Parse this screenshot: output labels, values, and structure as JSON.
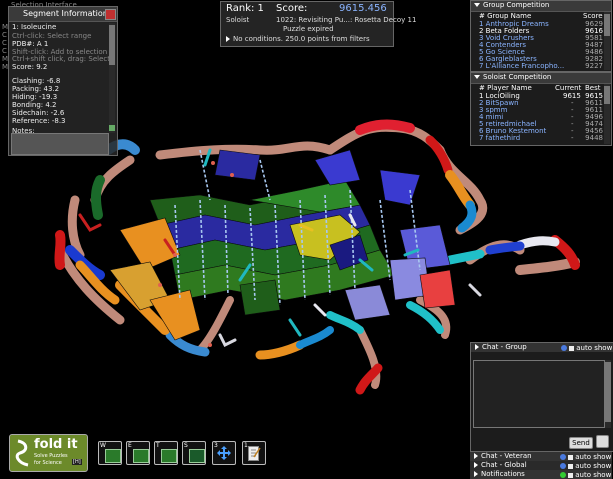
{
  "segment_panel": {
    "title": "Segment Information",
    "overlay_lines": [
      "Selection Interface",
      "M",
      "C",
      "C",
      "C",
      "M",
      "M"
    ],
    "residue": "1: Isoleucine",
    "hint_lines": [
      "Ctrl-click: Select range",
      "Shift-click: Add to selection",
      "Ctrl+shift click, drag: Select"
    ],
    "pdb": "PDB#: A 1",
    "score": "Score: 9.2",
    "stats": [
      "Clashing: -6.8",
      "Packing: 43.2",
      "Hiding: -19.3",
      "Bonding: 4.2",
      "Sidechain: -2.6",
      "Reference: -8.3"
    ],
    "notes_label": "Notes:"
  },
  "rank_panel": {
    "rank": "Rank: 1",
    "score_label": "Score:",
    "score_value": "9615.456",
    "mode": "Soloist",
    "puzzle": "1022: Revisiting Pu...: Rosetta Decoy 11",
    "status": "Puzzle expired",
    "conditions": "No conditions. 250.0 points from filters"
  },
  "group_competition": {
    "title": "Group Competition",
    "columns": [
      "# Group Name",
      "Score"
    ],
    "rows": [
      {
        "name": "1 Anthropic Dreams",
        "score": "9629"
      },
      {
        "name": "2 Beta Folders",
        "score": "9616"
      },
      {
        "name": "3 Void Crushers",
        "score": "9581"
      },
      {
        "name": "4 Contenders",
        "score": "9487"
      },
      {
        "name": "5 Go Science",
        "score": "9486"
      },
      {
        "name": "6 Gargleblasters",
        "score": "9282"
      },
      {
        "name": "7 L'Alliance Francopho...",
        "score": "9227"
      }
    ],
    "selected_index": 1
  },
  "soloist_competition": {
    "title": "Soloist Competition",
    "columns": [
      "# Player Name",
      "Current",
      "Best"
    ],
    "rows": [
      {
        "name": "1 LociOiling",
        "current": "9615",
        "best": "9615"
      },
      {
        "name": "2 BitSpawn",
        "current": "-",
        "best": "9611"
      },
      {
        "name": "3 spmm",
        "current": "-",
        "best": "9611"
      },
      {
        "name": "4 mimi",
        "current": "-",
        "best": "9496"
      },
      {
        "name": "5 retiredmichael",
        "current": "-",
        "best": "9474"
      },
      {
        "name": "6 Bruno Kestemont",
        "current": "-",
        "best": "9456"
      },
      {
        "name": "7 fathethird",
        "current": "-",
        "best": "9448"
      }
    ],
    "selected_index": 0
  },
  "chat": {
    "group_title": "Chat - Group",
    "veteran_title": "Chat - Veteran",
    "global_title": "Chat - Global",
    "notifications_title": "Notifications",
    "auto_show": "auto show",
    "send_label": "Send"
  },
  "logo": {
    "name": "fold it",
    "sub1": "Solve Puzzles",
    "sub2": "for Science",
    "level": "[H]"
  },
  "toolbar": [
    {
      "key": "W",
      "icon": "wiggle-icon"
    },
    {
      "key": "E",
      "icon": "shake-icon"
    },
    {
      "key": "T",
      "icon": "tweak-icon"
    },
    {
      "key": "S",
      "icon": "sidechain-icon"
    },
    {
      "key": "3",
      "icon": "move-arrows-icon"
    },
    {
      "key": "1",
      "icon": "notepad-icon"
    }
  ],
  "colors": {
    "panel_bg": "#282828",
    "score_blue": "#8ab4ff",
    "sheet_green": "#1f5e1a",
    "helix_blue": "#2a2aa0",
    "loop_tan": "#c08a7a",
    "clash_red": "#d01818"
  }
}
